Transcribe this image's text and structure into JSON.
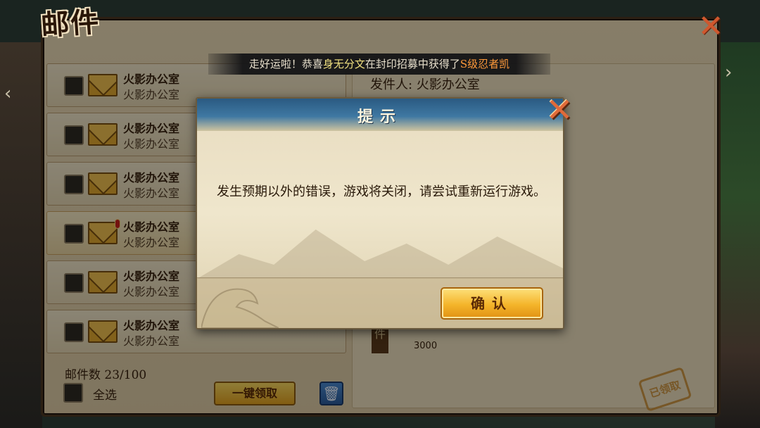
{
  "window": {
    "title": "邮件",
    "close_icon": "close-x-icon"
  },
  "banner": {
    "prefix": "走好运啦！恭喜",
    "player": "身无分文",
    "middle": "在封印招募中获得了",
    "reward": "S级忍者凯"
  },
  "mail_list": {
    "items": [
      {
        "sender": "火影办公室",
        "subtitle": "火影办公室",
        "icon": "envelope-icon",
        "unread_dot": false
      },
      {
        "sender": "火影办公室",
        "subtitle": "火影办公室",
        "icon": "envelope-icon",
        "unread_dot": false
      },
      {
        "sender": "火影办公室",
        "subtitle": "火影办公室",
        "icon": "envelope-icon",
        "unread_dot": false
      },
      {
        "sender": "火影办公室",
        "subtitle": "火影办公室",
        "icon": "envelope-icon",
        "unread_dot": true
      },
      {
        "sender": "火影办公室",
        "subtitle": "火影办公室",
        "icon": "envelope-icon",
        "unread_dot": false
      },
      {
        "sender": "火影办公室",
        "subtitle": "火影办公室",
        "icon": "envelope-icon",
        "unread_dot": false
      }
    ],
    "count_label": "邮件数",
    "count_value": "23/100",
    "select_all": "全选",
    "claim_all": "一键领取",
    "delete_icon": "trash-icon"
  },
  "detail": {
    "sender_label": "发件人: 火影办公室",
    "attachment_label": "件",
    "attachment_count": "3000",
    "stamp": "已领取"
  },
  "dialog": {
    "title": "提示",
    "message": "发生预期以外的错误，游戏将关闭，请尝试重新运行游戏。",
    "confirm": "确认",
    "close_icon": "close-x-icon"
  }
}
